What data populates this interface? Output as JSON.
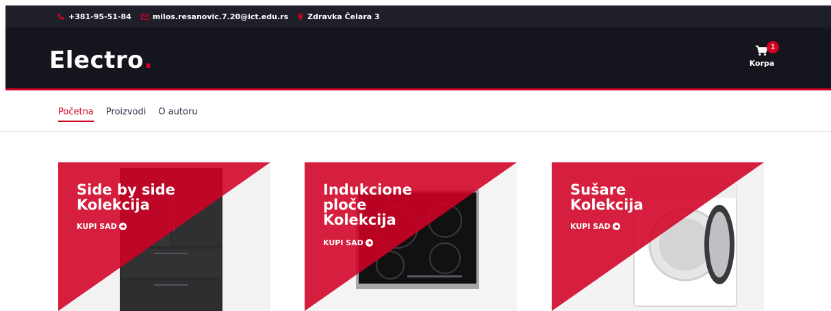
{
  "topbar": {
    "phone": "+381-95-51-84",
    "email": "milos.resanovic.7.20@ict.edu.rs",
    "address": "Zdravka Čelara 3"
  },
  "header": {
    "logo_text": "Electro",
    "logo_dot": ".",
    "cart_label": "Korpa",
    "cart_count": "1"
  },
  "nav": {
    "items": [
      {
        "label": "Početna",
        "active": true
      },
      {
        "label": "Proizvodi",
        "active": false
      },
      {
        "label": "O autoru",
        "active": false
      }
    ]
  },
  "collections": [
    {
      "title": "Side by side\nKolekcija",
      "cta": "KUPI SAD",
      "image": "refrigerator"
    },
    {
      "title": "Indukcione\nploče\nKolekcija",
      "cta": "KUPI SAD",
      "image": "induction-cooktop"
    },
    {
      "title": "Sušare\nKolekcija",
      "cta": "KUPI SAD",
      "image": "dryer"
    }
  ],
  "colors": {
    "accent": "#d10024",
    "header_bg": "#15161d",
    "topbar_bg": "#1e1f29"
  }
}
